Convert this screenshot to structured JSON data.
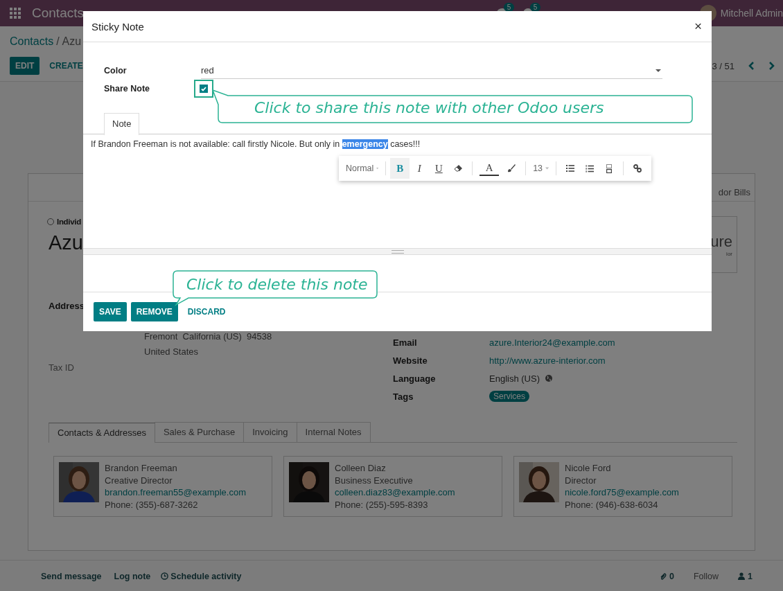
{
  "navbar": {
    "brand": "Contacts",
    "messages_badge": "5",
    "activities_badge": "5",
    "user": "Mitchell Admin"
  },
  "control_panel": {
    "breadcrumb": [
      {
        "label": "Contacts"
      },
      {
        "label": "Azu"
      }
    ],
    "separator": "/",
    "buttons": [
      {
        "label": "EDIT",
        "kind": "primary"
      },
      {
        "label": "CREATE",
        "kind": "secondary"
      }
    ],
    "pager": "3 / 51"
  },
  "form": {
    "smart_button": "dor Bills",
    "company_type": {
      "label": "Individ",
      "selected": false
    },
    "name": "Azu",
    "logo": {
      "main": "ure",
      "sub": "ior"
    },
    "address_label": "Address",
    "address_lines": [
      "Fremont  California (US)  94538",
      "United States"
    ],
    "tax_label": "Tax ID",
    "fields": [
      {
        "label": "Email",
        "value": "azure.Interior24@example.com",
        "kind": "link"
      },
      {
        "label": "Website",
        "value": "http://www.azure-interior.com",
        "kind": "link"
      },
      {
        "label": "Language",
        "value": "English (US)",
        "kind": "language"
      },
      {
        "label": "Tags",
        "value": "Services",
        "kind": "tag"
      }
    ],
    "tabs": [
      {
        "label": "Contacts & Addresses",
        "selected": true
      },
      {
        "label": "Sales & Purchase",
        "selected": false
      },
      {
        "label": "Invoicing",
        "selected": false
      },
      {
        "label": "Internal Notes",
        "selected": false
      }
    ],
    "contacts": [
      {
        "name": "Brandon Freeman",
        "title": "Creative Director",
        "email": "brandon.freeman55@example.com",
        "phone": "Phone: (355)-687-3262"
      },
      {
        "name": "Colleen Diaz",
        "title": "Business Executive",
        "email": "colleen.diaz83@example.com",
        "phone": "Phone: (255)-595-8393"
      },
      {
        "name": "Nicole Ford",
        "title": "Director",
        "email": "nicole.ford75@example.com",
        "phone": "Phone: (946)-638-6034"
      }
    ]
  },
  "chatter": {
    "actions": [
      {
        "label": "Send message",
        "kind": "text"
      },
      {
        "label": "Log note",
        "kind": "text"
      },
      {
        "label": "Schedule activity",
        "kind": "clock"
      }
    ],
    "attachments": "0",
    "follow": "Follow",
    "followers": "1"
  },
  "dialog": {
    "title": "Sticky Note",
    "close": "×",
    "fields": [
      {
        "label": "Color",
        "value": "red",
        "kind": "select"
      },
      {
        "label": "Share Note",
        "kind": "checkbox",
        "checked": true,
        "highlighted": true
      }
    ],
    "tabs": [
      {
        "label": "Note",
        "selected": true
      }
    ],
    "note": {
      "before": "If Brandon Freeman is not available: call firstly Nicole. But only in ",
      "selection": "emergency",
      "after": " cases!!!"
    },
    "toolbar": [
      {
        "items": [
          {
            "kind": "dropdown",
            "label": "Normal",
            "active": false
          }
        ]
      },
      {
        "items": [
          {
            "kind": "bold",
            "label": "B",
            "active": true
          },
          {
            "kind": "italic",
            "label": "I",
            "active": false
          },
          {
            "kind": "underline",
            "label": "U",
            "active": false
          },
          {
            "kind": "eraser",
            "active": false
          }
        ]
      },
      {
        "items": [
          {
            "kind": "text-color",
            "label": "A",
            "active": false
          },
          {
            "kind": "highlight",
            "active": false
          }
        ]
      },
      {
        "items": [
          {
            "kind": "dropdown",
            "label": "13",
            "active": false
          }
        ]
      },
      {
        "items": [
          {
            "kind": "bullets",
            "active": false
          },
          {
            "kind": "numbers",
            "active": false
          },
          {
            "kind": "checklist",
            "active": false
          }
        ]
      },
      {
        "items": [
          {
            "kind": "link",
            "active": false
          }
        ]
      }
    ],
    "buttons": [
      {
        "label": "SAVE",
        "kind": "primary"
      },
      {
        "label": "REMOVE",
        "kind": "primary"
      },
      {
        "label": "DISCARD",
        "kind": "link"
      }
    ],
    "tips": [
      {
        "text": "Click to share this note with other Odoo users"
      },
      {
        "text": "Click to delete this note"
      }
    ]
  }
}
